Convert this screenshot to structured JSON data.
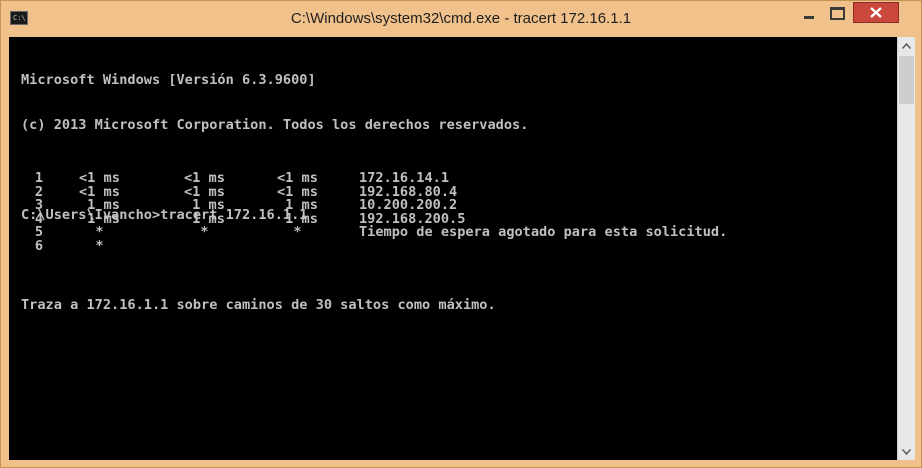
{
  "window": {
    "title": "C:\\Windows\\system32\\cmd.exe - tracert  172.16.1.1",
    "icon": "cmd-app-icon",
    "icon_text": "C:\\",
    "controls": [
      "minimize-icon",
      "maximize-icon",
      "close-icon"
    ],
    "frame_color": "#f0c18a",
    "close_color": "#c9473b"
  },
  "console": {
    "background": "#000000",
    "text_color": "#c0c0c0",
    "lines": [
      "Microsoft Windows [Versión 6.3.9600]",
      "(c) 2013 Microsoft Corporation. Todos los derechos reservados.",
      "",
      "C:\\Users\\Ivancho>tracert 172.16.1.1",
      "",
      "Traza a 172.16.1.1 sobre caminos de 30 saltos como máximo."
    ],
    "hops": [
      {
        "num": "1",
        "t1": "<1 ms",
        "t2": "<1 ms",
        "t3": "<1 ms",
        "host": "172.16.14.1"
      },
      {
        "num": "2",
        "t1": "<1 ms",
        "t2": "<1 ms",
        "t3": "<1 ms",
        "host": "192.168.80.4"
      },
      {
        "num": "3",
        "t1": " 1 ms",
        "t2": " 1 ms",
        "t3": " 1 ms",
        "host": "10.200.200.2"
      },
      {
        "num": "4",
        "t1": " 1 ms",
        "t2": " 1 ms",
        "t3": " 1 ms",
        "host": "192.168.200.5"
      },
      {
        "num": "5",
        "t1": "  *",
        "t2": "  *",
        "t3": "  *",
        "host": "Tiempo de espera agotado para esta solicitud."
      },
      {
        "num": "6",
        "t1": "  *",
        "t2": "",
        "t3": "",
        "host": ""
      }
    ]
  },
  "scrollbar": {
    "up_icon": "scroll-up-arrow-icon",
    "down_icon": "scroll-down-arrow-icon"
  }
}
